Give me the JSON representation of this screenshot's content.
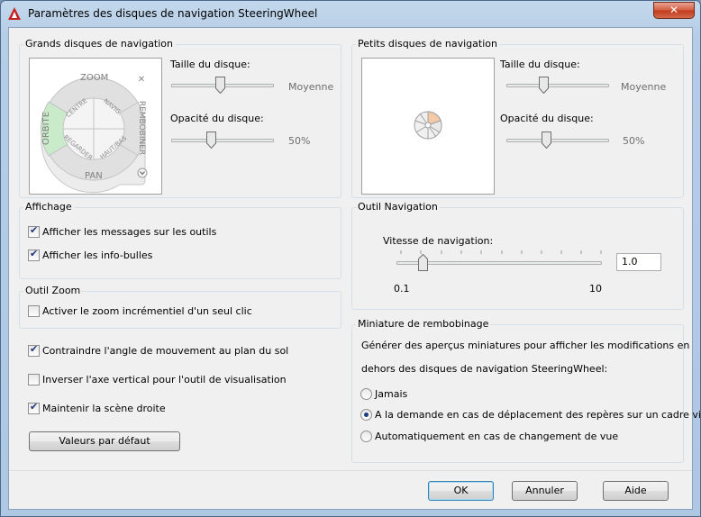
{
  "window": {
    "title": "Paramètres des disques de navigation SteeringWheel",
    "close_glyph": "✕"
  },
  "big_wheels": {
    "title": "Grands disques de navigation",
    "size_label": "Taille du disque:",
    "size_value": "Moyenne",
    "size_level": 0.48,
    "opacity_label": "Opacité du disque:",
    "opacity_value": "50%",
    "opacity_level": 0.38,
    "wheel": {
      "zoom": "ZOOM",
      "orbit": "ORBITE",
      "pan": "PAN",
      "rewind": "REMBOBINER",
      "center": "CENTRE",
      "nav": "NAVIG.",
      "look": "REGARDER",
      "updown": "HAUT/BAS"
    }
  },
  "small_wheels": {
    "title": "Petits disques de navigation",
    "size_label": "Taille du disque:",
    "size_value": "Moyenne",
    "size_level": 0.35,
    "opacity_label": "Opacité du disque:",
    "opacity_value": "50%",
    "opacity_level": 0.38
  },
  "display": {
    "title": "Affichage",
    "show_messages": "Afficher les messages sur les outils",
    "show_messages_checked": true,
    "show_tooltips": "Afficher les info-bulles",
    "show_tooltips_checked": true
  },
  "zoom_tool": {
    "title": "Outil Zoom",
    "incremental_zoom": "Activer le zoom incrémentiel d'un seul clic",
    "incremental_zoom_checked": false
  },
  "options": {
    "constrain_orbit": "Contraindre l'angle de mouvement au plan du sol",
    "constrain_orbit_checked": true,
    "invert_axis": "Inverser l'axe vertical pour l'outil de visualisation",
    "invert_axis_checked": false,
    "keep_upright": "Maintenir la scène droite",
    "keep_upright_checked": true,
    "defaults_button": "Valeurs par défaut"
  },
  "walk_tool": {
    "title": "Outil Navigation",
    "speed_label": "Vitesse de navigation:",
    "speed_value": "1.0",
    "speed_min": "0.1",
    "speed_max": "10",
    "speed_level": 0.11
  },
  "rewind_thumbnail": {
    "title": "Miniature de rembobinage",
    "description_line1": "Générer des aperçus miniatures pour afficher les modifications en",
    "description_line2": "dehors des disques de navigation SteeringWheel:",
    "never": "Jamais",
    "on_demand": "A la demande en cas de déplacement des repères sur un cadre vide",
    "automatic": "Automatiquement en cas de changement de vue",
    "selected": "on_demand"
  },
  "footer": {
    "ok": "OK",
    "cancel": "Annuler",
    "help": "Aide"
  },
  "colors": {
    "accent": "#1a3f86",
    "brand_red": "#c8201f",
    "orbit_green": "#c9ebc9"
  }
}
